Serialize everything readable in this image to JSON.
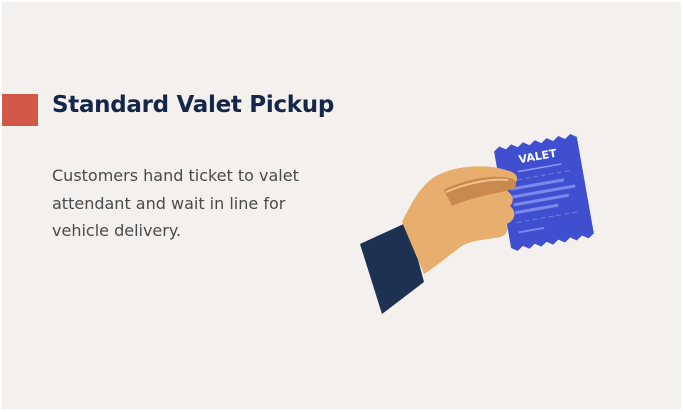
{
  "slide": {
    "title": "Standard Valet Pickup",
    "description": "Customers hand ticket to valet attendant and wait in line for vehicle delivery.",
    "ticket_label": "VALET"
  },
  "colors": {
    "background": "#f4f0ed",
    "accent": "#d2584a",
    "title": "#14274a",
    "text": "#4a4a4a",
    "ticket": "#3f4fcf",
    "skin": "#e8ae6e",
    "sleeve": "#1d3152"
  },
  "icons": [
    "hand-holding-ticket-icon"
  ]
}
